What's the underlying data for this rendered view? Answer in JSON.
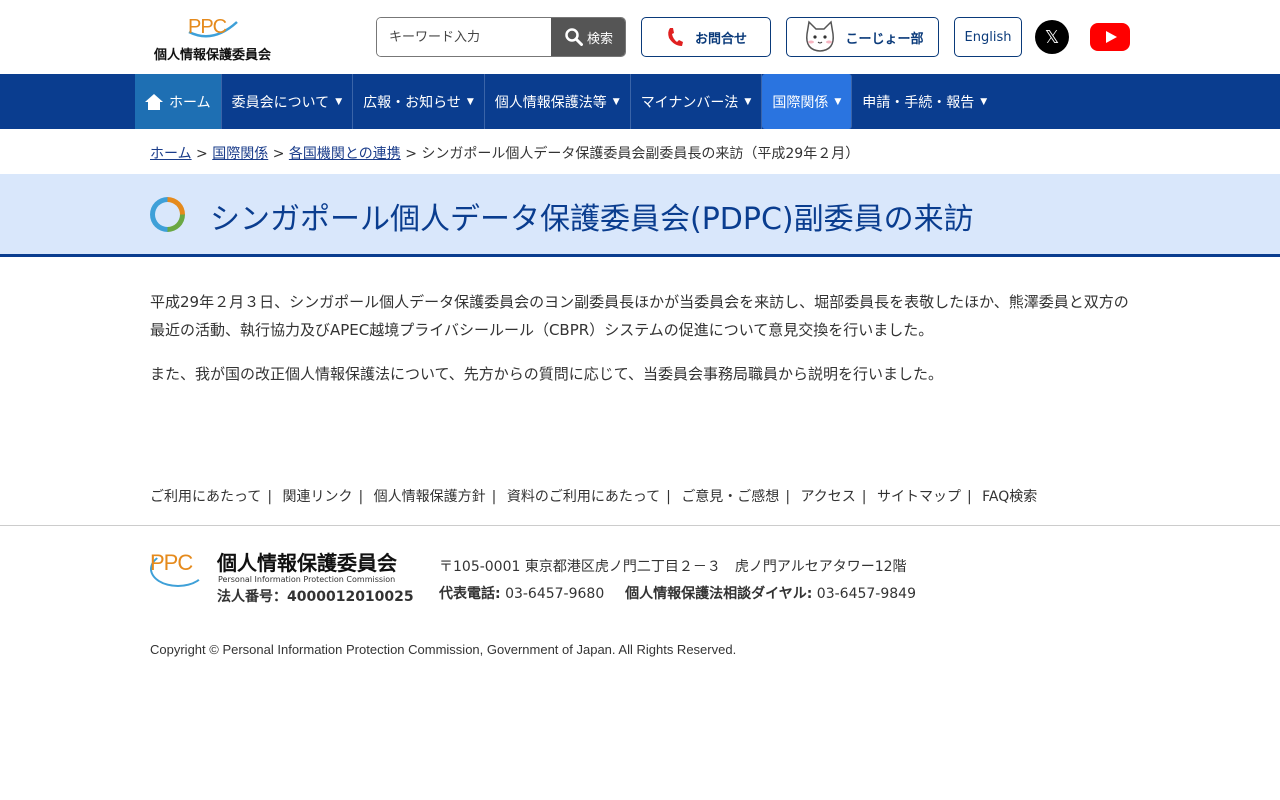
{
  "header": {
    "logo_ppc": "PPC",
    "logo_name": "個人情報保護委員会",
    "search_placeholder": "キーワード入力",
    "search_button": "検索",
    "contact_label": "お問合せ",
    "club_label": "こーじょー部",
    "english_label": "English",
    "x_label": "𝕏"
  },
  "nav": {
    "items": [
      {
        "label": "ホーム"
      },
      {
        "label": "委員会について"
      },
      {
        "label": "広報・お知らせ"
      },
      {
        "label": "個人情報保護法等"
      },
      {
        "label": "マイナンバー法"
      },
      {
        "label": "国際関係"
      },
      {
        "label": "申請・手続・報告"
      }
    ]
  },
  "breadcrumb": {
    "home": "ホーム",
    "intl": "国際関係",
    "coop": "各国機関との連携",
    "current": "シンガポール個人データ保護委員会副委員長の来訪（平成29年２月）"
  },
  "page": {
    "title": "シンガポール個人データ保護委員会(PDPC)副委員の来訪",
    "para1": "平成29年２月３日、シンガポール個人データ保護委員会のヨン副委員長ほかが当委員会を来訪し、堀部委員長を表敬したほか、熊澤委員と双方の最近の活動、執行協力及びAPEC越境プライバシールール（CBPR）システムの促進について意見交換を行いました。",
    "para2": "また、我が国の改正個人情報保護法について、先方からの質問に応じて、当委員会事務局職員から説明を行いました。"
  },
  "footer": {
    "links": [
      "ご利用にあたって",
      "関連リンク",
      "個人情報保護方針",
      "資料のご利用にあたって",
      "ご意見・ご感想",
      "アクセス",
      "サイトマップ",
      "FAQ検索"
    ],
    "logo_ppc": "PPC",
    "logo_jp": "個人情報保護委員会",
    "logo_en": "Personal Information Protection Commission",
    "corp_number": "法人番号：4000012010025",
    "address": "〒105-0001 東京都港区虎ノ門二丁目２－３　虎ノ門アルセアタワー12階",
    "tel_label": "代表電話:",
    "tel": "03-6457-9680",
    "consult_label": "個人情報保護法相談ダイヤル:",
    "consult_tel": "03-6457-9849",
    "copyright": "Copyright © Personal Information Protection Commission, Government of Japan. All Rights Reserved."
  }
}
